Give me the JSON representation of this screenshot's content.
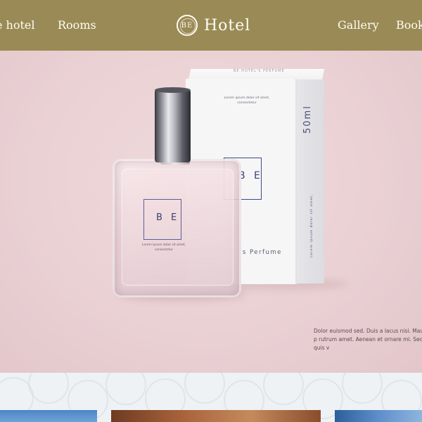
{
  "nav": {
    "left_links": [
      "e hotel",
      "Rooms"
    ],
    "right_links": [
      "Gallery",
      "Book"
    ],
    "brand_mark": "BE",
    "brand_name": "Hotel"
  },
  "hero": {
    "box": {
      "top_text": "BE HOTEL'S PERFUME",
      "small_text": "Lorem ipsum dolor sit amet, consectetur",
      "logo": "B E",
      "perfume_label": "'s Perfume",
      "side_volume": "50ml",
      "side_small": "Lorem ipsum dolor sit amet,"
    },
    "bottle": {
      "logo": "B E",
      "small_text": "Lorem ipsum dolor sit amet, consectetur"
    },
    "caption": "Dolor euismod sed. Duis a lacus nisi. Mauris p rutrum amet. Aenean et ornare mi. Sed quis v"
  },
  "colors": {
    "nav_bg": "#9a8a55",
    "nav_text": "#fffdf5",
    "hero_bg": "#ead1d4",
    "pattern_bg": "#eef2f5"
  }
}
